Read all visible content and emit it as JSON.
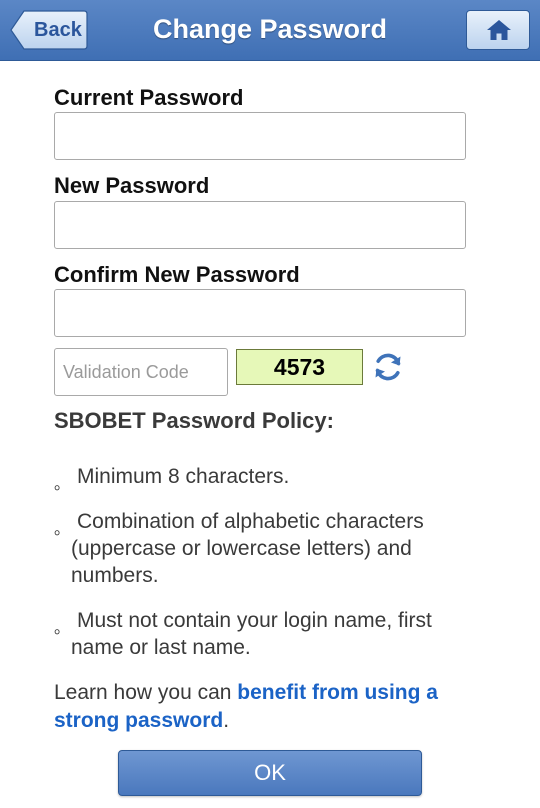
{
  "header": {
    "title": "Change Password",
    "back_label": "Back",
    "home_icon": "home-icon"
  },
  "form": {
    "current_password_label": "Current Password",
    "current_password_value": "",
    "new_password_label": "New Password",
    "new_password_value": "",
    "confirm_password_label": "Confirm New Password",
    "confirm_password_value": "",
    "validation_placeholder": "Validation Code",
    "validation_value": "",
    "captcha_code": "4573",
    "refresh_icon": "refresh-icon"
  },
  "policy": {
    "title": "SBOBET Password Policy:",
    "bullet": "。",
    "items": [
      "Minimum 8 characters.",
      "Combination of alphabetic characters (uppercase or lowercase letters) and numbers.",
      "Must not contain your login name, first name or last name."
    ]
  },
  "learn": {
    "prefix": "Learn how you can ",
    "link_text": "benefit from using a strong password",
    "suffix": "."
  },
  "ok_label": "OK",
  "colors": {
    "header": "#4a7abd",
    "link": "#1b63c6",
    "captcha_bg": "#e6f8b8"
  }
}
